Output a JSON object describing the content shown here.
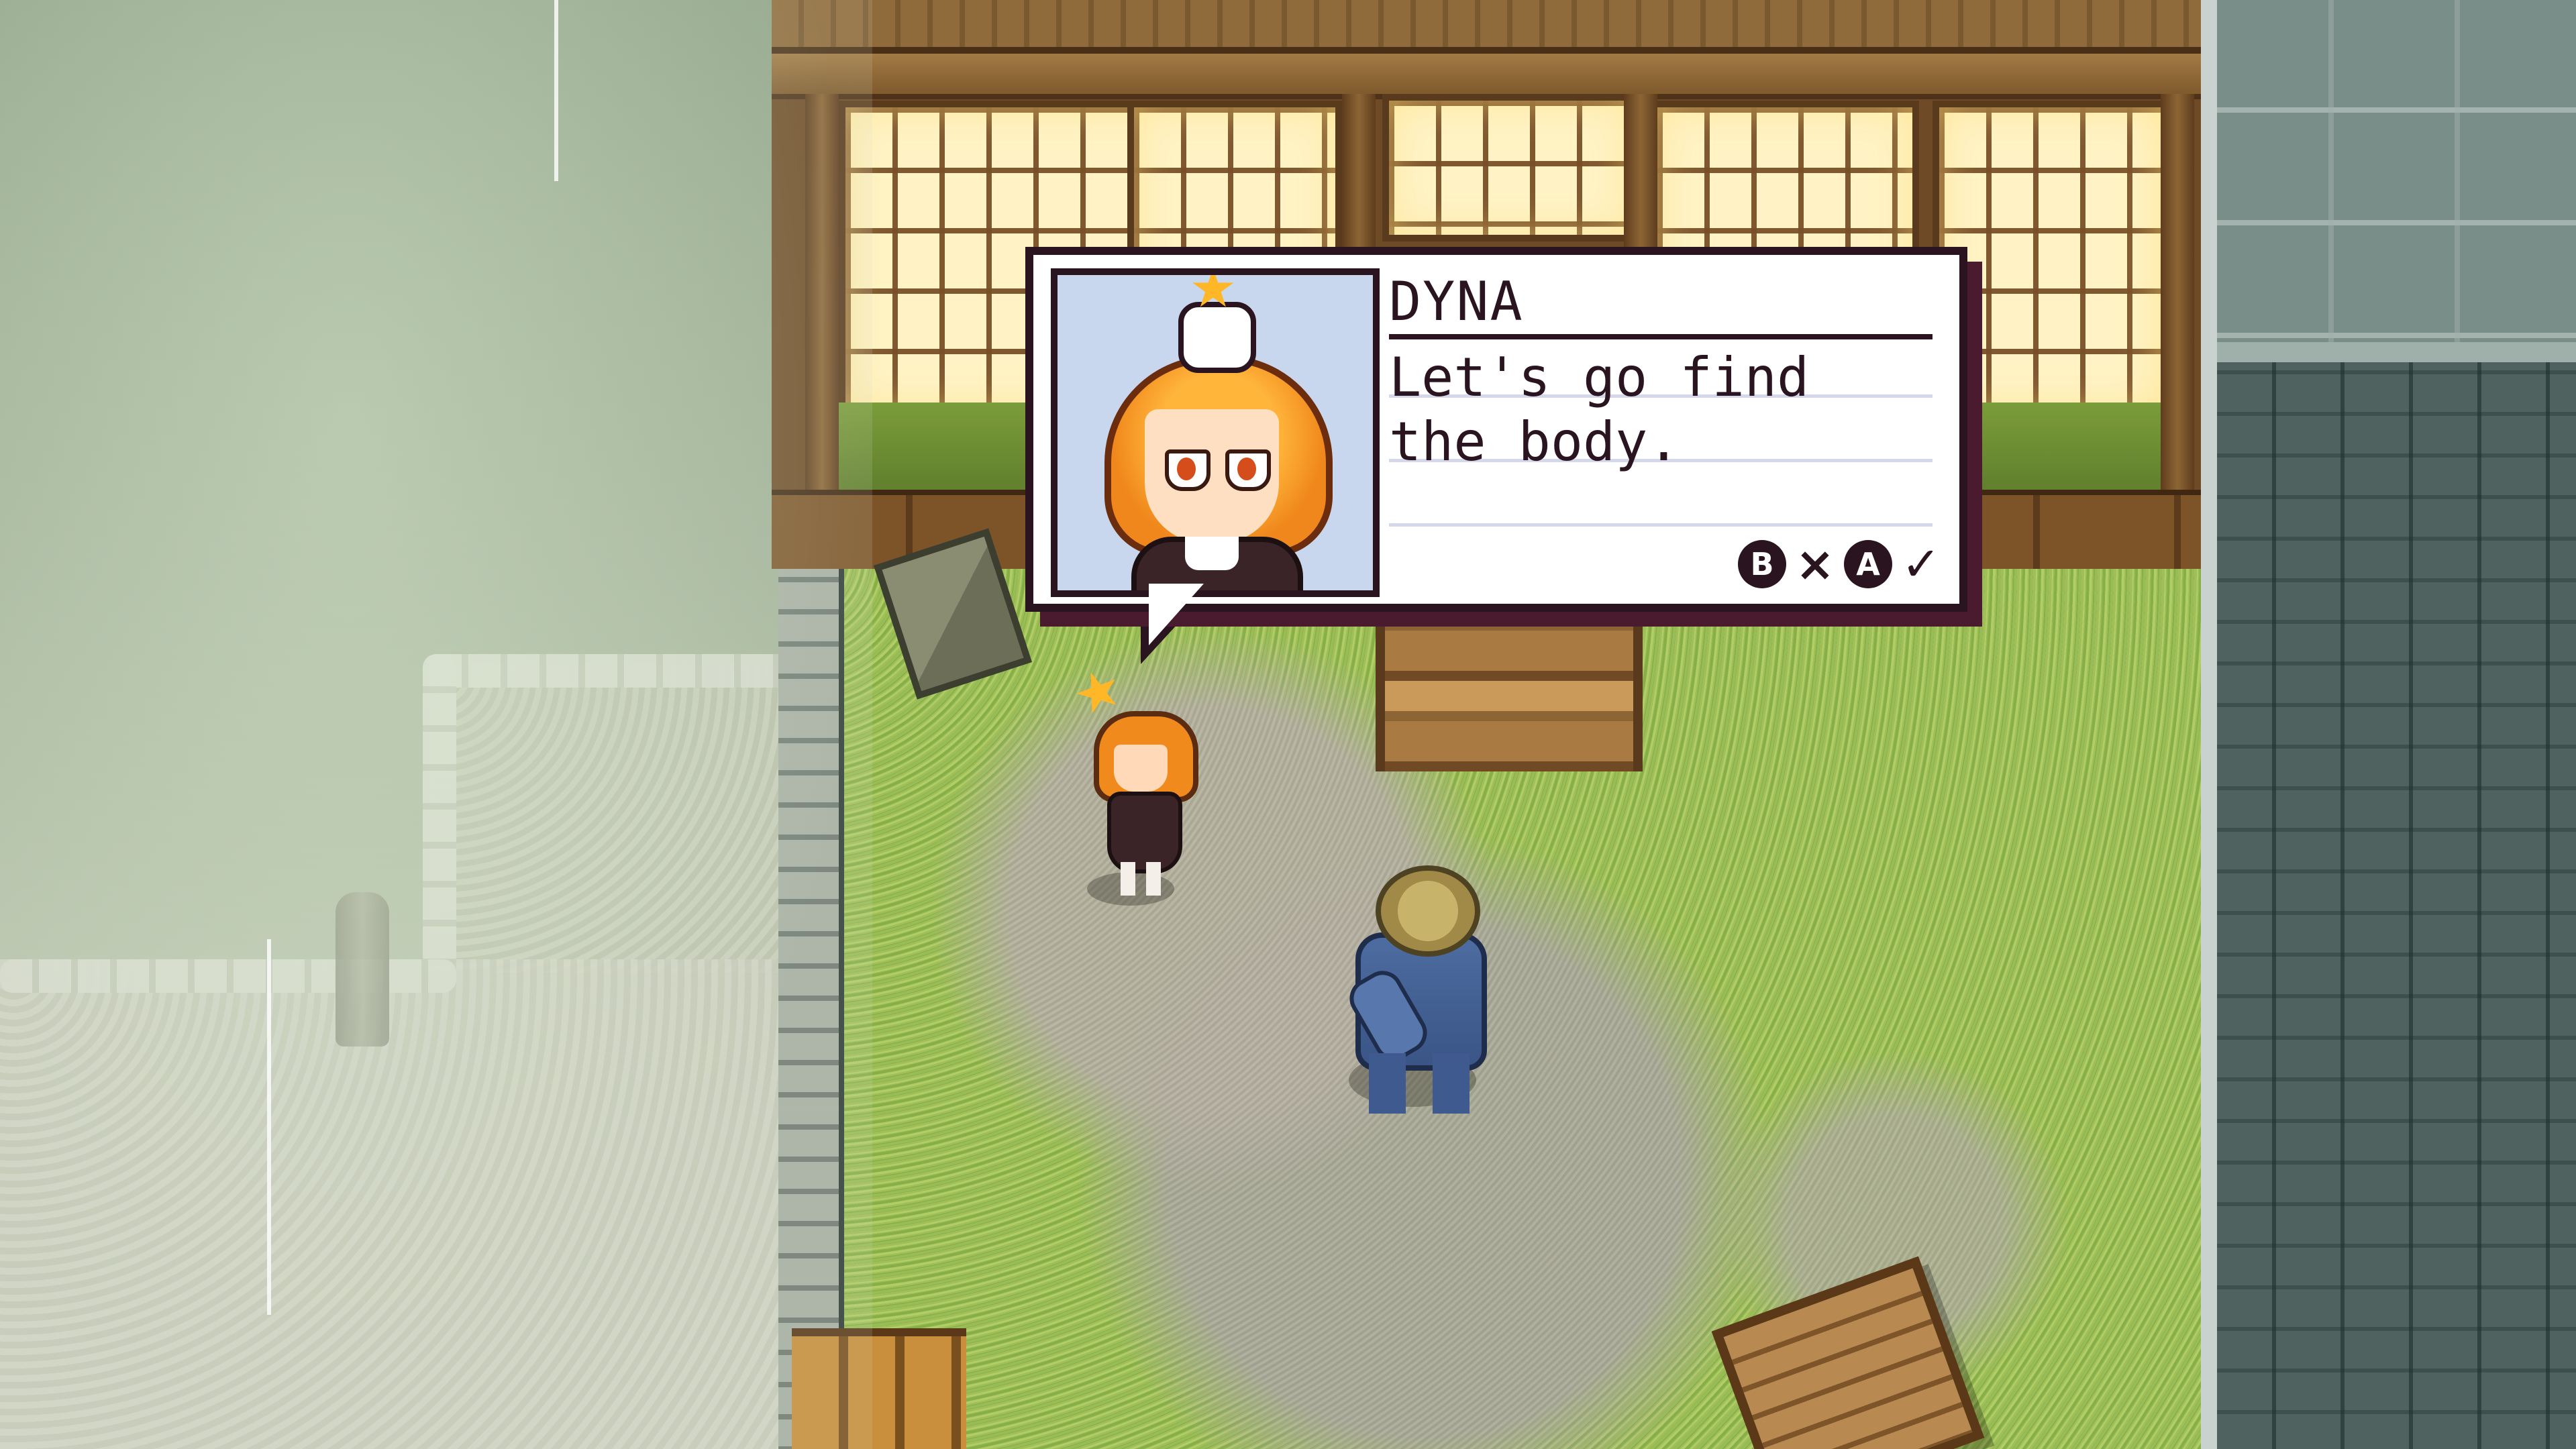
{
  "dialog": {
    "speaker": "DYNA",
    "text": "Let's go find the body.",
    "buttons": [
      {
        "key": "B",
        "action_icon": "cancel-x"
      },
      {
        "key": "A",
        "action_icon": "confirm-check"
      }
    ]
  },
  "icons": {
    "cancel": "×",
    "confirm": "✓",
    "star": "★"
  },
  "colors": {
    "dialog_border": "#2a1420",
    "dialog_shadow": "#4a1a2e",
    "portrait_bg": "#c9d7ee",
    "hair": "#f08a1c"
  }
}
